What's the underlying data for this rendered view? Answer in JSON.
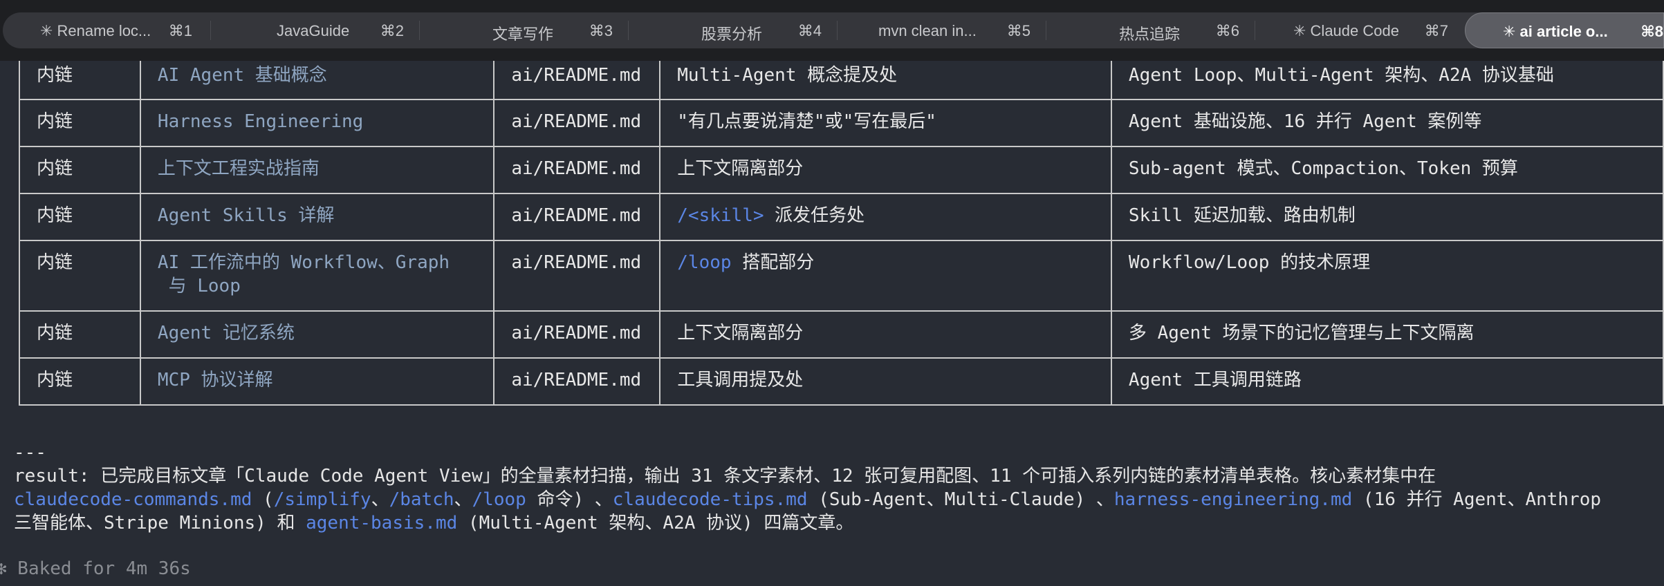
{
  "tabs": [
    {
      "title": "✳ Rename loc...",
      "shortcut": "⌘1"
    },
    {
      "title": "JavaGuide",
      "shortcut": "⌘2"
    },
    {
      "title": "文章写作",
      "shortcut": "⌘3"
    },
    {
      "title": "股票分析",
      "shortcut": "⌘4"
    },
    {
      "title": "mvn clean in...",
      "shortcut": "⌘5"
    },
    {
      "title": "热点追踪",
      "shortcut": "⌘6"
    },
    {
      "title": "✳ Claude Code",
      "shortcut": "⌘7"
    },
    {
      "title": "✳ ai article o...",
      "shortcut": "⌘8",
      "active": true
    }
  ],
  "table": {
    "rows": [
      {
        "type": "内链",
        "title_line1": "AI Agent 基础概念",
        "title_line2": "",
        "file": "ai/README.md",
        "pos_prefix": "",
        "pos_text": "Multi-Agent 概念提及处",
        "desc": "Agent Loop、Multi-Agent 架构、A2A 协议基础"
      },
      {
        "type": "内链",
        "title_line1": "Harness Engineering",
        "title_line2": "",
        "file": "ai/README.md",
        "pos_prefix": "",
        "pos_text": "\"有几点要说清楚\"或\"写在最后\"",
        "desc": "Agent 基础设施、16 并行 Agent 案例等"
      },
      {
        "type": "内链",
        "title_line1": "上下文工程实战指南",
        "title_line2": "",
        "file": "ai/README.md",
        "pos_prefix": "",
        "pos_text": "上下文隔离部分",
        "desc": "Sub-agent 模式、Compaction、Token 预算"
      },
      {
        "type": "内链",
        "title_line1": "Agent Skills 详解",
        "title_line2": "",
        "file": "ai/README.md",
        "pos_prefix": "/<skill>",
        "pos_text": " 派发任务处",
        "desc": "Skill 延迟加载、路由机制"
      },
      {
        "type": "内链",
        "title_line1": "AI 工作流中的 Workflow、Graph",
        "title_line2": " 与 Loop",
        "file": "ai/README.md",
        "pos_prefix": "/loop",
        "pos_text": " 搭配部分",
        "desc": "Workflow/Loop 的技术原理"
      },
      {
        "type": "内链",
        "title_line1": "Agent 记忆系统",
        "title_line2": "",
        "file": "ai/README.md",
        "pos_prefix": "",
        "pos_text": "上下文隔离部分",
        "desc": "多 Agent 场景下的记忆管理与上下文隔离"
      },
      {
        "type": "内链",
        "title_line1": "MCP 协议详解",
        "title_line2": "",
        "file": "ai/README.md",
        "pos_prefix": "",
        "pos_text": "工具调用提及处",
        "desc": "Agent 工具调用链路"
      }
    ]
  },
  "output": {
    "separator": "---",
    "result_line1": "result: 已完成目标文章「Claude Code Agent View」的全量素材扫描，输出 31 条文字素材、12 张可复用配图、11 个可插入系列内链的素材清单表格。核心素材集中在",
    "l2_link1": "claudecode-commands.md",
    "l2_t1": " (",
    "l2_cmd1": "/simplify",
    "l2_t2": "、",
    "l2_cmd2": "/batch",
    "l2_t3": "、",
    "l2_cmd3": "/loop",
    "l2_t4": " 命令) 、",
    "l2_link2": "claudecode-tips.md",
    "l2_t5": " (Sub-Agent、Multi-Claude) 、",
    "l2_link3": "harness-engineering.md",
    "l2_t6": " (16 并行 Agent、Anthrop",
    "l3_t1": "三智能体、Stripe Minions) 和 ",
    "l3_link": "agent-basis.md",
    "l3_t2": " (Multi-Agent 架构、A2A 协议) 四篇文章。",
    "status": "✻ Baked for 4m 36s"
  }
}
